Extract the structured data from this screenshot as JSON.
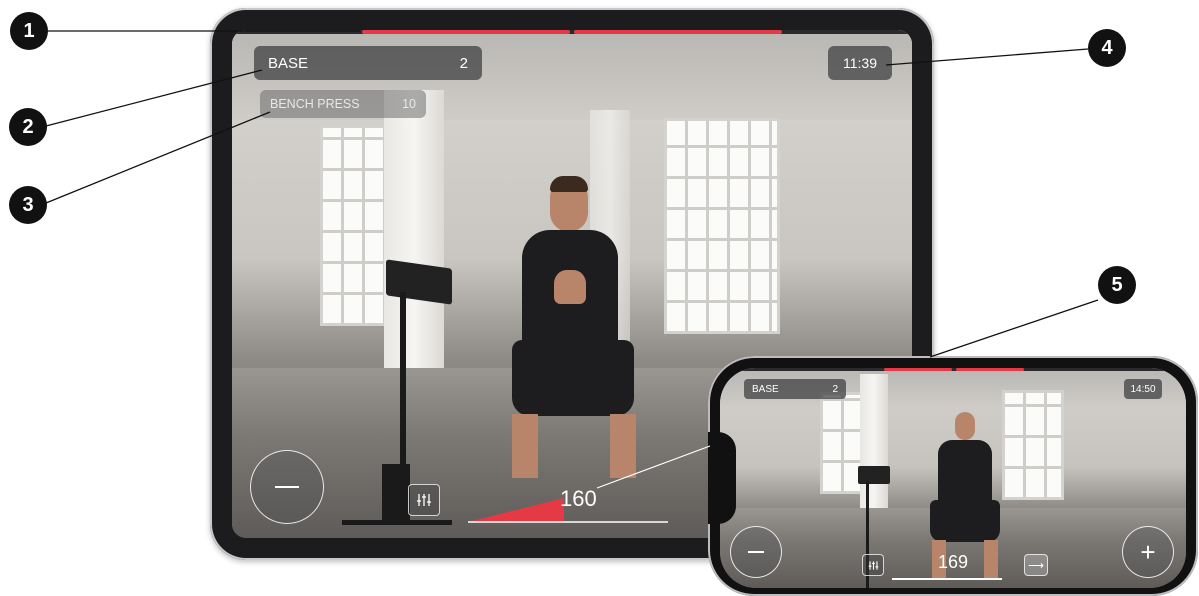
{
  "callouts": [
    "1",
    "2",
    "3",
    "4",
    "5"
  ],
  "tablet": {
    "program": {
      "name": "BASE",
      "count": "2"
    },
    "exercise": {
      "name": "BENCH PRESS",
      "count": "10"
    },
    "timer": "11:39",
    "intensity": "160",
    "progress": {
      "segments_total": 2,
      "segments_done": 2
    },
    "buttons": {
      "minus": "—",
      "settings_icon": "sliders-icon"
    }
  },
  "phone": {
    "program": {
      "name": "BASE",
      "count": "2"
    },
    "timer": "14:50",
    "intensity": "169",
    "buttons": {
      "minus": "—",
      "plus": "+",
      "settings_icon": "sliders-icon",
      "next_icon": "arrow-right-icon"
    }
  },
  "colors": {
    "accent": "#e63946",
    "pill": "#3c3c3e"
  }
}
